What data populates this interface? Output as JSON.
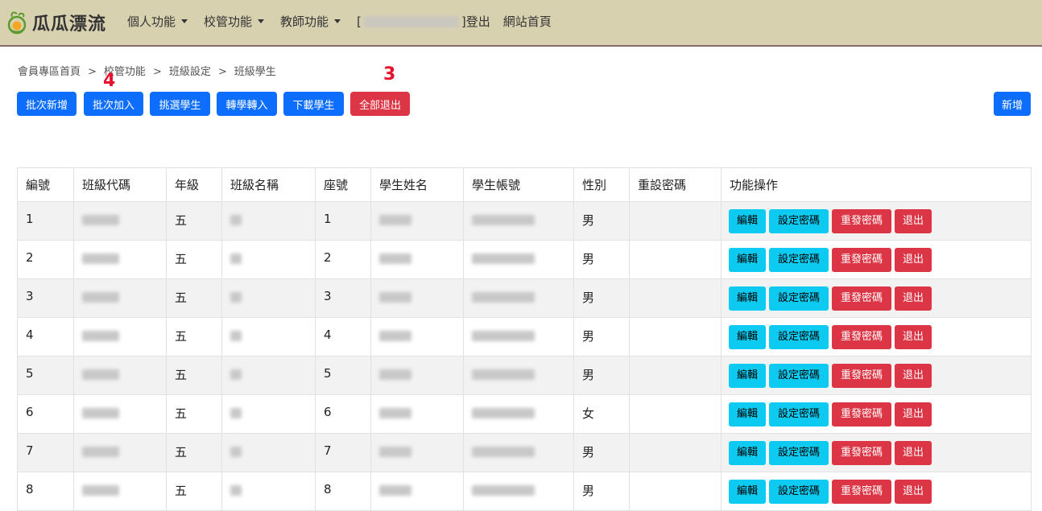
{
  "brand": {
    "name": "瓜瓜漂流"
  },
  "nav": {
    "items": [
      "個人功能",
      "校管功能",
      "教師功能"
    ],
    "bracket_open": "[",
    "bracket_close": "]",
    "logout": "登出",
    "home": "網站首頁"
  },
  "breadcrumb": [
    "會員專區首頁",
    "校管功能",
    "班級設定",
    "班級學生"
  ],
  "breadcrumb_sep": ">",
  "toolbar": {
    "batch_create": "批次新增",
    "batch_join": "批次加入",
    "pick_students": "挑選學生",
    "transfer_in": "轉學轉入",
    "download": "下載學生",
    "exit_all": "全部退出",
    "add_new": "新增"
  },
  "annotations": {
    "a4": "4",
    "a3": "3"
  },
  "table": {
    "headers": [
      "編號",
      "班級代碼",
      "年級",
      "班級名稱",
      "座號",
      "學生姓名",
      "學生帳號",
      "性別",
      "重設密碼",
      "功能操作"
    ],
    "actions": {
      "edit": "編輯",
      "set_password": "設定密碼",
      "resend_password": "重發密碼",
      "exit": "退出"
    },
    "rows": [
      {
        "id": "1",
        "grade": "五",
        "seat": "1",
        "gender": "男"
      },
      {
        "id": "2",
        "grade": "五",
        "seat": "2",
        "gender": "男"
      },
      {
        "id": "3",
        "grade": "五",
        "seat": "3",
        "gender": "男"
      },
      {
        "id": "4",
        "grade": "五",
        "seat": "4",
        "gender": "男"
      },
      {
        "id": "5",
        "grade": "五",
        "seat": "5",
        "gender": "男"
      },
      {
        "id": "6",
        "grade": "五",
        "seat": "6",
        "gender": "女"
      },
      {
        "id": "7",
        "grade": "五",
        "seat": "7",
        "gender": "男"
      },
      {
        "id": "8",
        "grade": "五",
        "seat": "8",
        "gender": "男"
      }
    ]
  },
  "colors": {
    "navbar_bg": "#d8d1b0",
    "primary": "#0d6efd",
    "danger": "#dc3545",
    "info": "#0dcaf0",
    "annotation": "#e8112d"
  }
}
